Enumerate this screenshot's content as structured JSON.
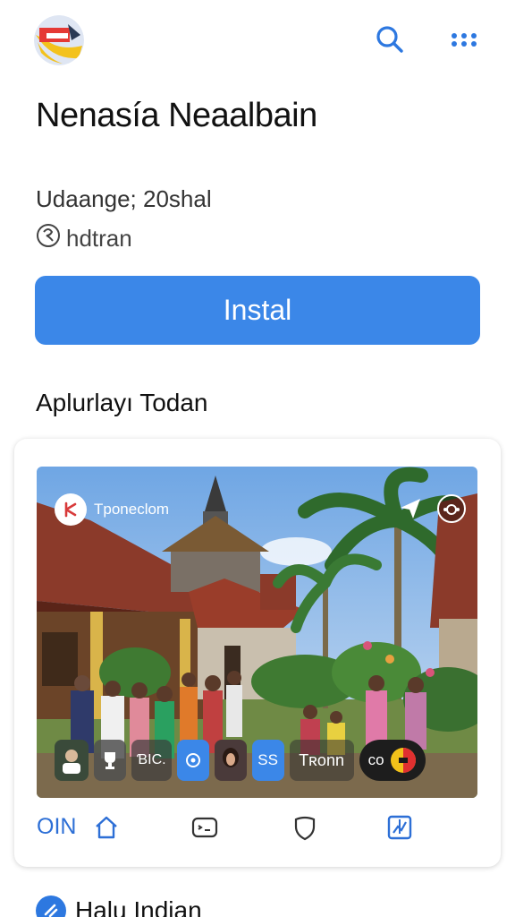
{
  "header": {
    "logo_icon": "flag-logo-icon",
    "search_icon": "search-icon",
    "more_icon": "more-horizontal-icon",
    "accent": "#2d78e0"
  },
  "app": {
    "title": "Nenasía Neaalbain",
    "update": "Udaange; 20shal",
    "developer": "hdtran",
    "install_label": "Instal",
    "install_color": "#3b87e8"
  },
  "section": {
    "title": "Aplurlayı Todan"
  },
  "media": {
    "channel_name": "Tponeclom",
    "strip": {
      "item_text_1": "ƁIC.",
      "item_text_2": "SS",
      "item_text_3": "Tʀonn",
      "item_text_4": "co"
    }
  },
  "tabs": {
    "label": "OIN",
    "icons": [
      "home-icon",
      "gamepad-icon",
      "shield-icon",
      "chart-icon"
    ]
  },
  "next": {
    "icon": "app-icon",
    "title": "Halu Indian"
  }
}
